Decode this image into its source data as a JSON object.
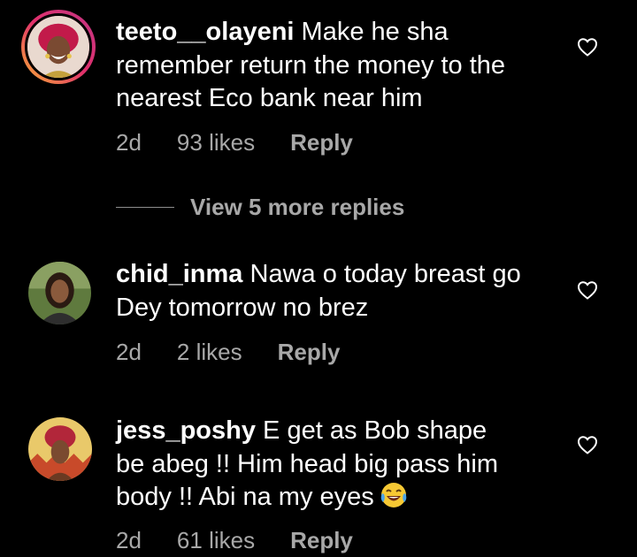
{
  "comments": [
    {
      "username": "teeto__olayeni",
      "text_lines": [
        "Make he sha",
        "remember return the money to the",
        "nearest Eco bank near him"
      ],
      "time": "2d",
      "likes": "93 likes",
      "reply": "Reply"
    },
    {
      "username": "chid_inma",
      "text_lines": [
        "Nawa o today breast go",
        "Dey tomorrow no brez"
      ],
      "time": "2d",
      "likes": "2 likes",
      "reply": "Reply"
    },
    {
      "username": "jess_poshy",
      "text_lines": [
        "E get as Bob shape",
        "be abeg !! Him head big pass him",
        "body !! Abi na my eyes"
      ],
      "emoji": "face-with-tears-of-joy",
      "time": "2d",
      "likes": "61 likes",
      "reply": "Reply"
    }
  ],
  "view_more": {
    "label": "View 5 more replies"
  },
  "icons": {
    "like": "heart-outline-icon"
  },
  "colors": {
    "background": "#000000",
    "text": "#ffffff",
    "secondary": "#a8a8a8"
  }
}
